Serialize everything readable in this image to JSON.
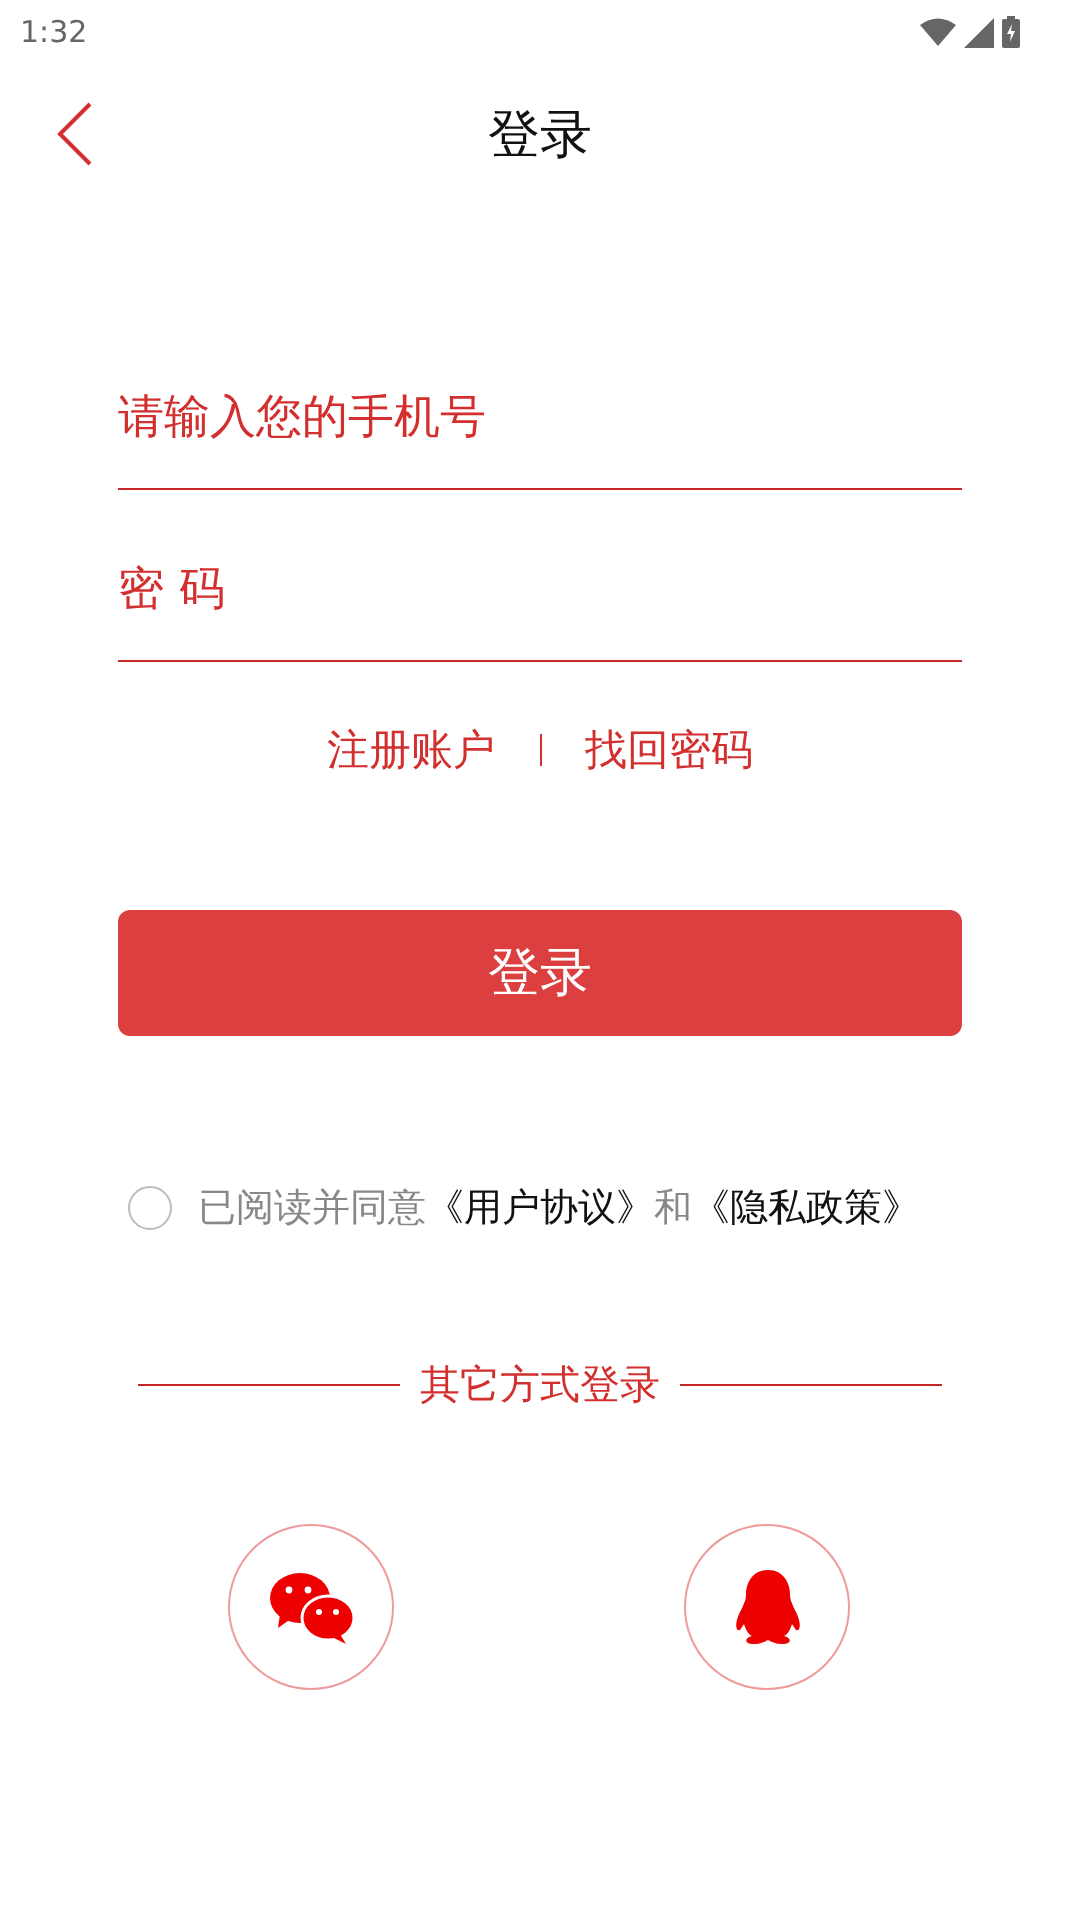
{
  "status_bar": {
    "time": "1:32"
  },
  "header": {
    "title": "登录"
  },
  "fields": [
    {
      "placeholder": "请输入您的手机号"
    },
    {
      "placeholder": "密 码"
    }
  ],
  "links": [
    "注册账户",
    "找回密码"
  ],
  "login_button": "登录",
  "agreement": {
    "checked": false,
    "prefix": "已阅读并同意",
    "terms": "《用户协议》",
    "joiner": "和",
    "privacy": "《隐私政策》"
  },
  "other_login": {
    "label": "其它方式登录",
    "options": [
      {
        "kind": "chat"
      },
      {
        "kind": "penguin"
      }
    ]
  }
}
